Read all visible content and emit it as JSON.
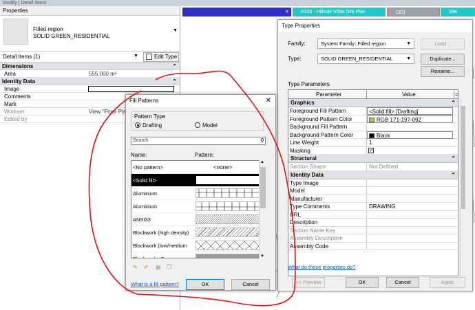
{
  "top_strip": "Modify | Detail Items",
  "properties": {
    "title": "Properties",
    "type_family": "Filled region",
    "type_name": "SOLID GREEN_RESIDENTIAL",
    "selector": "Detail Items (1)",
    "edit_type": "Edit Type",
    "groups": [
      {
        "name": "Dimensions",
        "rows": [
          {
            "k": "Area",
            "v": "555.000 m²"
          }
        ]
      },
      {
        "name": "Identity Data",
        "rows": [
          {
            "k": "Image",
            "v": ""
          },
          {
            "k": "Comments",
            "v": ""
          },
          {
            "k": "Mark",
            "v": ""
          },
          {
            "k": "Workset",
            "v": "View \"Floor Pla"
          },
          {
            "k": "Edited by",
            "v": ""
          }
        ]
      }
    ]
  },
  "tabs": [
    {
      "label": "",
      "close": "✕",
      "color": "#2e2ec8"
    },
    {
      "label": "A100 - Hillside Villas Site Plan",
      "close": "",
      "color": "#20c8c8"
    },
    {
      "label": "{3D}",
      "close": "",
      "color": "#9aa2aa"
    },
    {
      "label": "Site",
      "close": "",
      "color": "#20c8c8"
    }
  ],
  "type_props": {
    "title": "Type Properties",
    "family_label": "Family:",
    "family_value": "System Family: Filled region",
    "type_label": "Type:",
    "type_value": "SOLID GREEN_RESIDENTIAL",
    "load": "Load...",
    "duplicate": "Duplicate...",
    "rename": "Rename...",
    "params_label": "Type Parameters",
    "col_param": "Parameter",
    "col_value": "Value",
    "col_eq": "=",
    "groups": [
      {
        "name": "Graphics",
        "rows": [
          {
            "k": "Foreground Fill Pattern",
            "v": "<Solid fill> [Drafting]",
            "boxed": true
          },
          {
            "k": "Foreground Pattern Color",
            "v": "RGB 171-197-092",
            "boxed": true,
            "swatch": "#abc55c"
          },
          {
            "k": "Background Fill Pattern",
            "v": ""
          },
          {
            "k": "Background Pattern Color",
            "v": "Black",
            "boxed": true,
            "swatch": "#000000"
          },
          {
            "k": "Line Weight",
            "v": "1"
          },
          {
            "k": "Masking",
            "v": "✓",
            "check": true
          }
        ]
      },
      {
        "name": "Structural",
        "rows": [
          {
            "k": "Section Shape",
            "v": "Not Defined",
            "gray": true
          }
        ]
      },
      {
        "name": "Identity Data",
        "rows": [
          {
            "k": "Type Image",
            "v": ""
          },
          {
            "k": "Model",
            "v": ""
          },
          {
            "k": "Manufacturer",
            "v": ""
          },
          {
            "k": "Type Comments",
            "v": "DRAWING"
          },
          {
            "k": "URL",
            "v": ""
          },
          {
            "k": "Description",
            "v": ""
          },
          {
            "k": "Section Name Key",
            "v": "",
            "gray": true
          },
          {
            "k": "Assembly Description",
            "v": "",
            "gray": true
          },
          {
            "k": "Assembly Code",
            "v": ""
          }
        ]
      }
    ],
    "help_link": "What do these properties do?",
    "preview": "<< Preview",
    "ok": "OK",
    "cancel": "Cancel",
    "apply": "Apply"
  },
  "fill_patterns": {
    "title": "Fill Patterns",
    "close": "✕",
    "pattern_type": "Pattern Type",
    "drafting": "Drafting",
    "model": "Model",
    "search_placeholder": "Search",
    "col_name": "Name:",
    "col_pattern": "Pattern:",
    "items": [
      {
        "name": "<No pattern>",
        "pattern": "<none>",
        "kind": "none"
      },
      {
        "name": "<Solid fill>",
        "pattern": "",
        "kind": "solid",
        "selected": true
      },
      {
        "name": "Aluminium",
        "pattern": "",
        "kind": "alu1"
      },
      {
        "name": "Aluminium",
        "pattern": "",
        "kind": "alu2"
      },
      {
        "name": "ANSI33",
        "pattern": "",
        "kind": "diag"
      },
      {
        "name": "Blockwork (high density)",
        "pattern": "",
        "kind": "cross"
      },
      {
        "name": "Blockwork (low/medium",
        "pattern": "",
        "kind": "cross2"
      },
      {
        "name": "Blockwork - Dense",
        "pattern": "",
        "kind": "dense"
      }
    ],
    "help_link": "What is a fill pattern?",
    "ok": "OK",
    "cancel": "Cancel",
    "annotation_color": "#e01010"
  }
}
